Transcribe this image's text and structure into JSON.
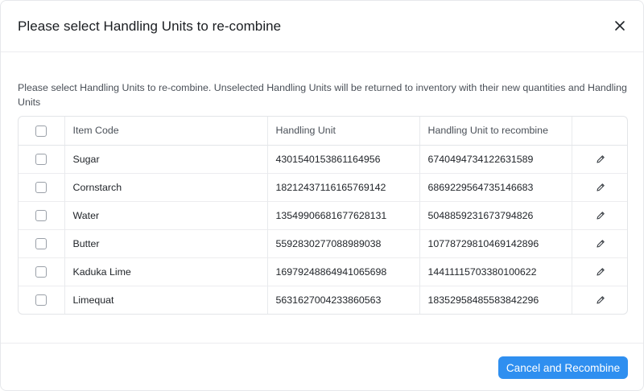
{
  "modal": {
    "title": "Please select Handling Units to re-combine",
    "description": "Please select Handling Units to re-combine. Unselected Handling Units will be returned to inventory with their new quantities and Handling Units",
    "close_icon": "close-icon"
  },
  "table": {
    "columns": [
      "Item Code",
      "Handling Unit",
      "Handling Unit to recombine"
    ],
    "rows": [
      {
        "item_code": "Sugar",
        "handling_unit": "4301540153861164956",
        "recombine_unit": "6740494734122631589"
      },
      {
        "item_code": "Cornstarch",
        "handling_unit": "18212437116165769142",
        "recombine_unit": "6869229564735146683"
      },
      {
        "item_code": "Water",
        "handling_unit": "13549906681677628131",
        "recombine_unit": "5048859231673794826"
      },
      {
        "item_code": "Butter",
        "handling_unit": "5592830277088989038",
        "recombine_unit": "10778729810469142896"
      },
      {
        "item_code": "Kaduka Lime",
        "handling_unit": "16979248864941065698",
        "recombine_unit": "14411115703380100622"
      },
      {
        "item_code": "Limequat",
        "handling_unit": "5631627004233860563",
        "recombine_unit": "18352958485583842296"
      }
    ],
    "row_icon": "pencil-icon"
  },
  "footer": {
    "primary_button_label": "Cancel and Recombine"
  }
}
